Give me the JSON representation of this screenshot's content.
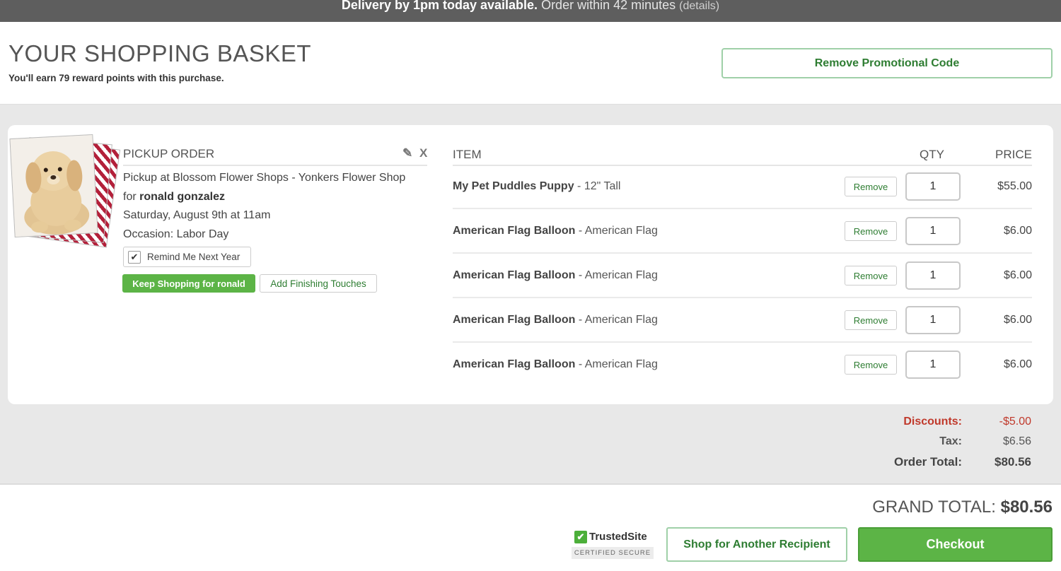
{
  "banner": {
    "strong": "Delivery by 1pm today available.",
    "soft": "Order within 42 minutes",
    "details": "(details)"
  },
  "header": {
    "title": "YOUR SHOPPING BASKET",
    "reward_prefix": "You'll earn",
    "reward_points": "79",
    "reward_suffix": "reward points with this purchase.",
    "promo_button": "Remove Promotional Code"
  },
  "order": {
    "section_title": "PICKUP ORDER",
    "edit_icon": "pencil-icon",
    "close_icon": "close-icon",
    "pickup_location": "Pickup at Blossom Flower Shops - Yonkers Flower Shop",
    "for_prefix": "for",
    "recipient": "ronald gonzalez",
    "date": "Saturday, August 9th at 11am",
    "occasion": "Occasion: Labor Day",
    "remind_label": "Remind Me Next Year",
    "remind_checked": true,
    "keep_shopping": "Keep Shopping for ronald",
    "finishing_touches": "Add Finishing Touches"
  },
  "items_table": {
    "headers": {
      "item": "ITEM",
      "qty": "QTY",
      "price": "PRICE"
    },
    "remove_label": "Remove",
    "rows": [
      {
        "name": "My Pet Puddles Puppy",
        "variant": "12\" Tall",
        "qty": "1",
        "price": "$55.00"
      },
      {
        "name": "American Flag Balloon",
        "variant": "American Flag",
        "qty": "1",
        "price": "$6.00"
      },
      {
        "name": "American Flag Balloon",
        "variant": "American Flag",
        "qty": "1",
        "price": "$6.00"
      },
      {
        "name": "American Flag Balloon",
        "variant": "American Flag",
        "qty": "1",
        "price": "$6.00"
      },
      {
        "name": "American Flag Balloon",
        "variant": "American Flag",
        "qty": "1",
        "price": "$6.00"
      }
    ]
  },
  "totals": {
    "discounts_label": "Discounts:",
    "discounts_value": "-$5.00",
    "tax_label": "Tax:",
    "tax_value": "$6.56",
    "order_total_label": "Order Total:",
    "order_total_value": "$80.56"
  },
  "footer": {
    "grand_total_label": "GRAND TOTAL:",
    "grand_total_value": "$80.56",
    "trusted_name": "TrustedSite",
    "trusted_sub": "CERTIFIED SECURE",
    "another_button": "Shop for Another Recipient",
    "checkout_button": "Checkout"
  },
  "colors": {
    "accent_green": "#5cb446",
    "link_green": "#2e7d32",
    "discount_red": "#c0392b",
    "banner_gray": "#5e5e5e"
  }
}
